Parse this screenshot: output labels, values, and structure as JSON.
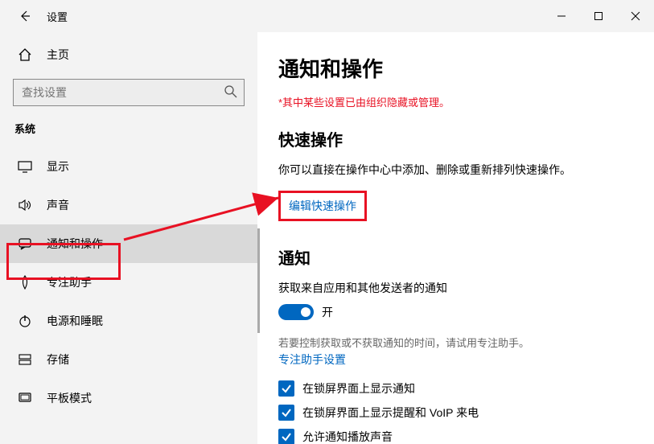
{
  "titlebar": {
    "title": "设置"
  },
  "sidebar": {
    "home_label": "主页",
    "search_placeholder": "查找设置",
    "section_label": "系统",
    "items": [
      {
        "label": "显示"
      },
      {
        "label": "声音"
      },
      {
        "label": "通知和操作"
      },
      {
        "label": "专注助手"
      },
      {
        "label": "电源和睡眠"
      },
      {
        "label": "存储"
      },
      {
        "label": "平板模式"
      }
    ]
  },
  "main": {
    "title": "通知和操作",
    "warning": "*其中某些设置已由组织隐藏或管理。",
    "quick_actions_heading": "快速操作",
    "quick_actions_desc": "你可以直接在操作中心中添加、删除或重新排列快速操作。",
    "edit_quick_actions_link": "编辑快速操作",
    "notifications_heading": "通知",
    "notifications_sub": "获取来自应用和其他发送者的通知",
    "toggle_state": "开",
    "focus_note": "若要控制获取或不获取通知的时间，请试用专注助手。",
    "focus_link": "专注助手设置",
    "checks": [
      {
        "label": "在锁屏界面上显示通知"
      },
      {
        "label": "在锁屏界面上显示提醒和 VoIP 来电"
      },
      {
        "label": "允许通知播放声音"
      }
    ]
  }
}
